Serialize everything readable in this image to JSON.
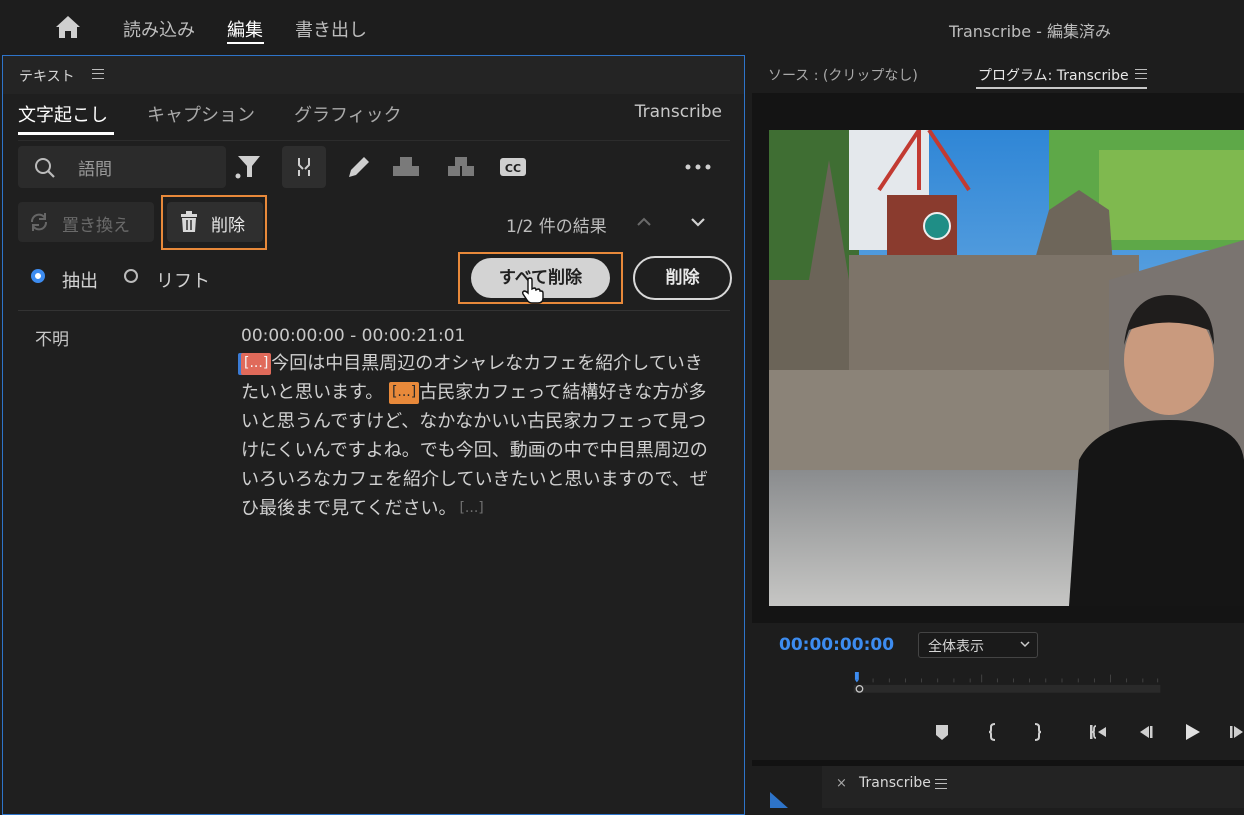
{
  "topbar": {
    "nav": [
      "読み込み",
      "編集",
      "書き出し"
    ],
    "active": "編集",
    "title": "Transcribe - 編集済み"
  },
  "left_panel": {
    "title": "テキスト",
    "tabs": [
      "文字起こし",
      "キャプション",
      "グラフィック"
    ],
    "active_tab": "文字起こし",
    "sequence": "Transcribe",
    "search": {
      "value": "語間"
    },
    "replace_label": "置き換え",
    "delete_label": "削除",
    "results": "1/2 件の結果",
    "radio": {
      "extract": "抽出",
      "lift": "リフト",
      "selected": "抽出"
    },
    "delete_all_label": "すべて削除",
    "delete_label2": "削除",
    "transcript": {
      "speaker": "不明",
      "timecode": "00:00:00:00 - 00:00:21:01",
      "pause_marker": "[...]",
      "segments": [
        "今回は中目黒周辺のオシャレなカフェを紹介していきたいと思います。",
        "古民家カフェって結構好きな方が多いと思うんですけど、なかなかいい古民家カフェって見つけにくいんですよね。でも今回、動画の中で中目黒周辺のいろいろなカフェを紹介していきたいと思いますので、ぜひ最後まで見てください。"
      ]
    }
  },
  "right_panel": {
    "source_tab": "ソース : (クリップなし)",
    "program_tab": "プログラム: Transcribe",
    "timecode": "00:00:00:00",
    "zoom": "全体表示",
    "bottom_tab": "Transcribe",
    "bottom_close": "×"
  },
  "colors": {
    "accent": "#3d8cf0",
    "highlight": "#e8893a",
    "pause_selected": "#e06a5a"
  },
  "icons": [
    "home-icon",
    "menu-icon",
    "search-icon",
    "filter-icon",
    "split-icon",
    "pencil-icon",
    "merge-icon",
    "unmerge-icon",
    "cc-icon",
    "more-icon",
    "replace-icon",
    "trash-icon",
    "chevron-up-icon",
    "chevron-down-icon",
    "cursor-hand-icon",
    "marker-icon",
    "in-point-icon",
    "out-point-icon",
    "go-to-in-icon",
    "step-back-icon",
    "play-icon",
    "step-forward-icon"
  ]
}
